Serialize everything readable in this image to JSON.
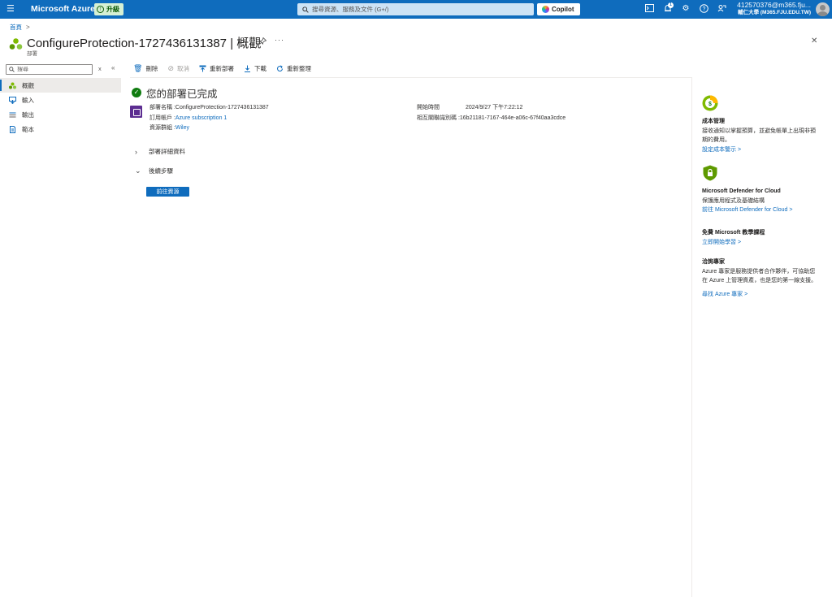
{
  "topbar": {
    "brand": "Microsoft Azure",
    "upgrade_label": "升級",
    "search_placeholder": "搜尋資源、服務及文件 (G+/)",
    "copilot_label": "Copilot",
    "notification_count": "1",
    "account_name": "412570376@m365.fju...",
    "account_org": "輔仁大學 (M365.FJU.EDU.TW)"
  },
  "breadcrumb": {
    "home": "首頁",
    "sep": ">"
  },
  "header": {
    "title": "ConfigureProtection-1727436131387 | 概觀",
    "subtitle": "部署",
    "more": "···",
    "close": "✕"
  },
  "nav": {
    "search_placeholder": "搜尋",
    "clear": "x",
    "collapse": "«",
    "items": [
      {
        "label": "概觀",
        "icon": "overview-icon"
      },
      {
        "label": "輸入",
        "icon": "inputs-icon"
      },
      {
        "label": "輸出",
        "icon": "outputs-icon"
      },
      {
        "label": "範本",
        "icon": "template-icon"
      }
    ]
  },
  "toolbar": {
    "delete": "刪除",
    "cancel": "取消",
    "redeploy": "重新部署",
    "download": "下載",
    "refresh": "重新整理"
  },
  "status": {
    "title": "您的部署已完成"
  },
  "details": {
    "left": [
      {
        "key": "部署名稱 : ",
        "value": "ConfigureProtection-1727436131387",
        "link": false
      },
      {
        "key": "訂用帳戶 : ",
        "value": "Azure subscription 1",
        "link": true
      },
      {
        "key": "資源群組 : ",
        "value": "Wiley",
        "link": true
      }
    ],
    "right": [
      {
        "key": "開始時間",
        "value": "2024/9/27 下午7:22:12"
      },
      {
        "key": "相互關聯識別碼 : ",
        "value": "16b21181-7167-464e-a06c-67f40aa3cdce"
      }
    ]
  },
  "sections": {
    "deployment_details": "部署詳細資料",
    "next_steps": "後續步驟",
    "goto_resource": "前往資源"
  },
  "right_panel": {
    "cost": {
      "title": "成本管理",
      "body1": "接收通知以掌握預算，並避免帳單上出現非預",
      "body2": "期的費用。",
      "link": "設定成本警示 >"
    },
    "defender": {
      "title": "Microsoft Defender for Cloud",
      "body": "保護應用程式及基礎結構",
      "link": "前往 Microsoft Defender for Cloud >"
    },
    "training": {
      "title": "免費 Microsoft 教學課程",
      "link": "立即開始學習 >"
    },
    "experts": {
      "title": "洽詢專家",
      "body1": "Azure 專家是服務提供者合作夥伴，可協助您",
      "body2": "在 Azure 上管理資產，也是您的第一線支援。",
      "link": "尋找 Azure 專家 >"
    }
  },
  "colors": {
    "brand_blue": "#0f6cbd",
    "success_green": "#107c10",
    "deploy_purple": "#5c2d91",
    "upgrade_bg": "#d6f0d4"
  }
}
